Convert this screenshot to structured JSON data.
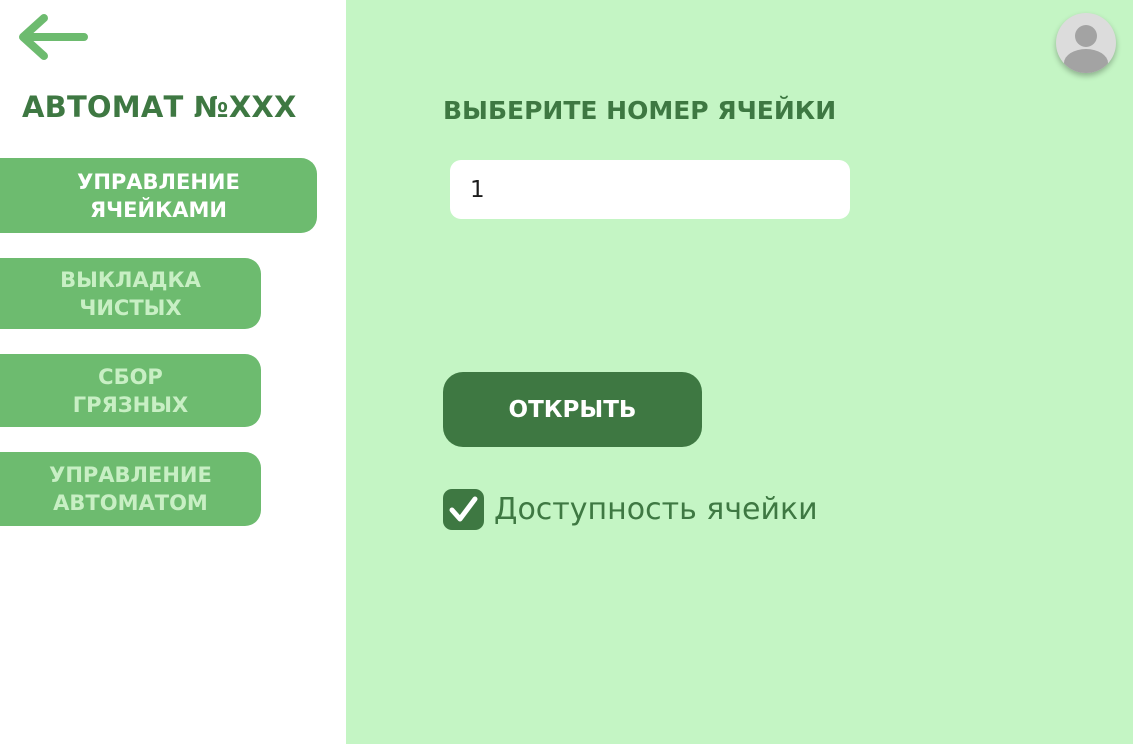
{
  "sidebar": {
    "back_icon": "arrow-left-icon",
    "title": "АВТОМАТ №XXX",
    "nav_items": [
      {
        "label": "УПРАВЛЕНИЕ\nЯЧЕЙКАМИ",
        "active": true
      },
      {
        "label": "ВЫКЛАДКА\nЧИСТЫХ",
        "active": false
      },
      {
        "label": "СБОР\nГРЯЗНЫХ",
        "active": false
      },
      {
        "label": "УПРАВЛЕНИЕ\nАВТОМАТОМ",
        "active": false
      }
    ]
  },
  "main": {
    "prompt": "ВЫБЕРИТЕ НОМЕР ЯЧЕЙКИ",
    "cell_number_value": "1",
    "open_button_label": "ОТКРЫТЬ",
    "availability_label": "Доступность ячейки",
    "availability_checked": true
  },
  "header": {
    "avatar_icon": "user-avatar-icon"
  },
  "colors": {
    "sidebar_background": "#ffffff",
    "main_background": "#c4f5c4",
    "nav_item_background": "#6dbb6f",
    "nav_item_active_text": "#ffffff",
    "nav_item_inactive_text": "#c8efc4",
    "dark_green": "#3e7842",
    "back_arrow": "#6dbb6f",
    "avatar_background": "#dcdcdc",
    "avatar_figure": "#a3a3a3"
  }
}
